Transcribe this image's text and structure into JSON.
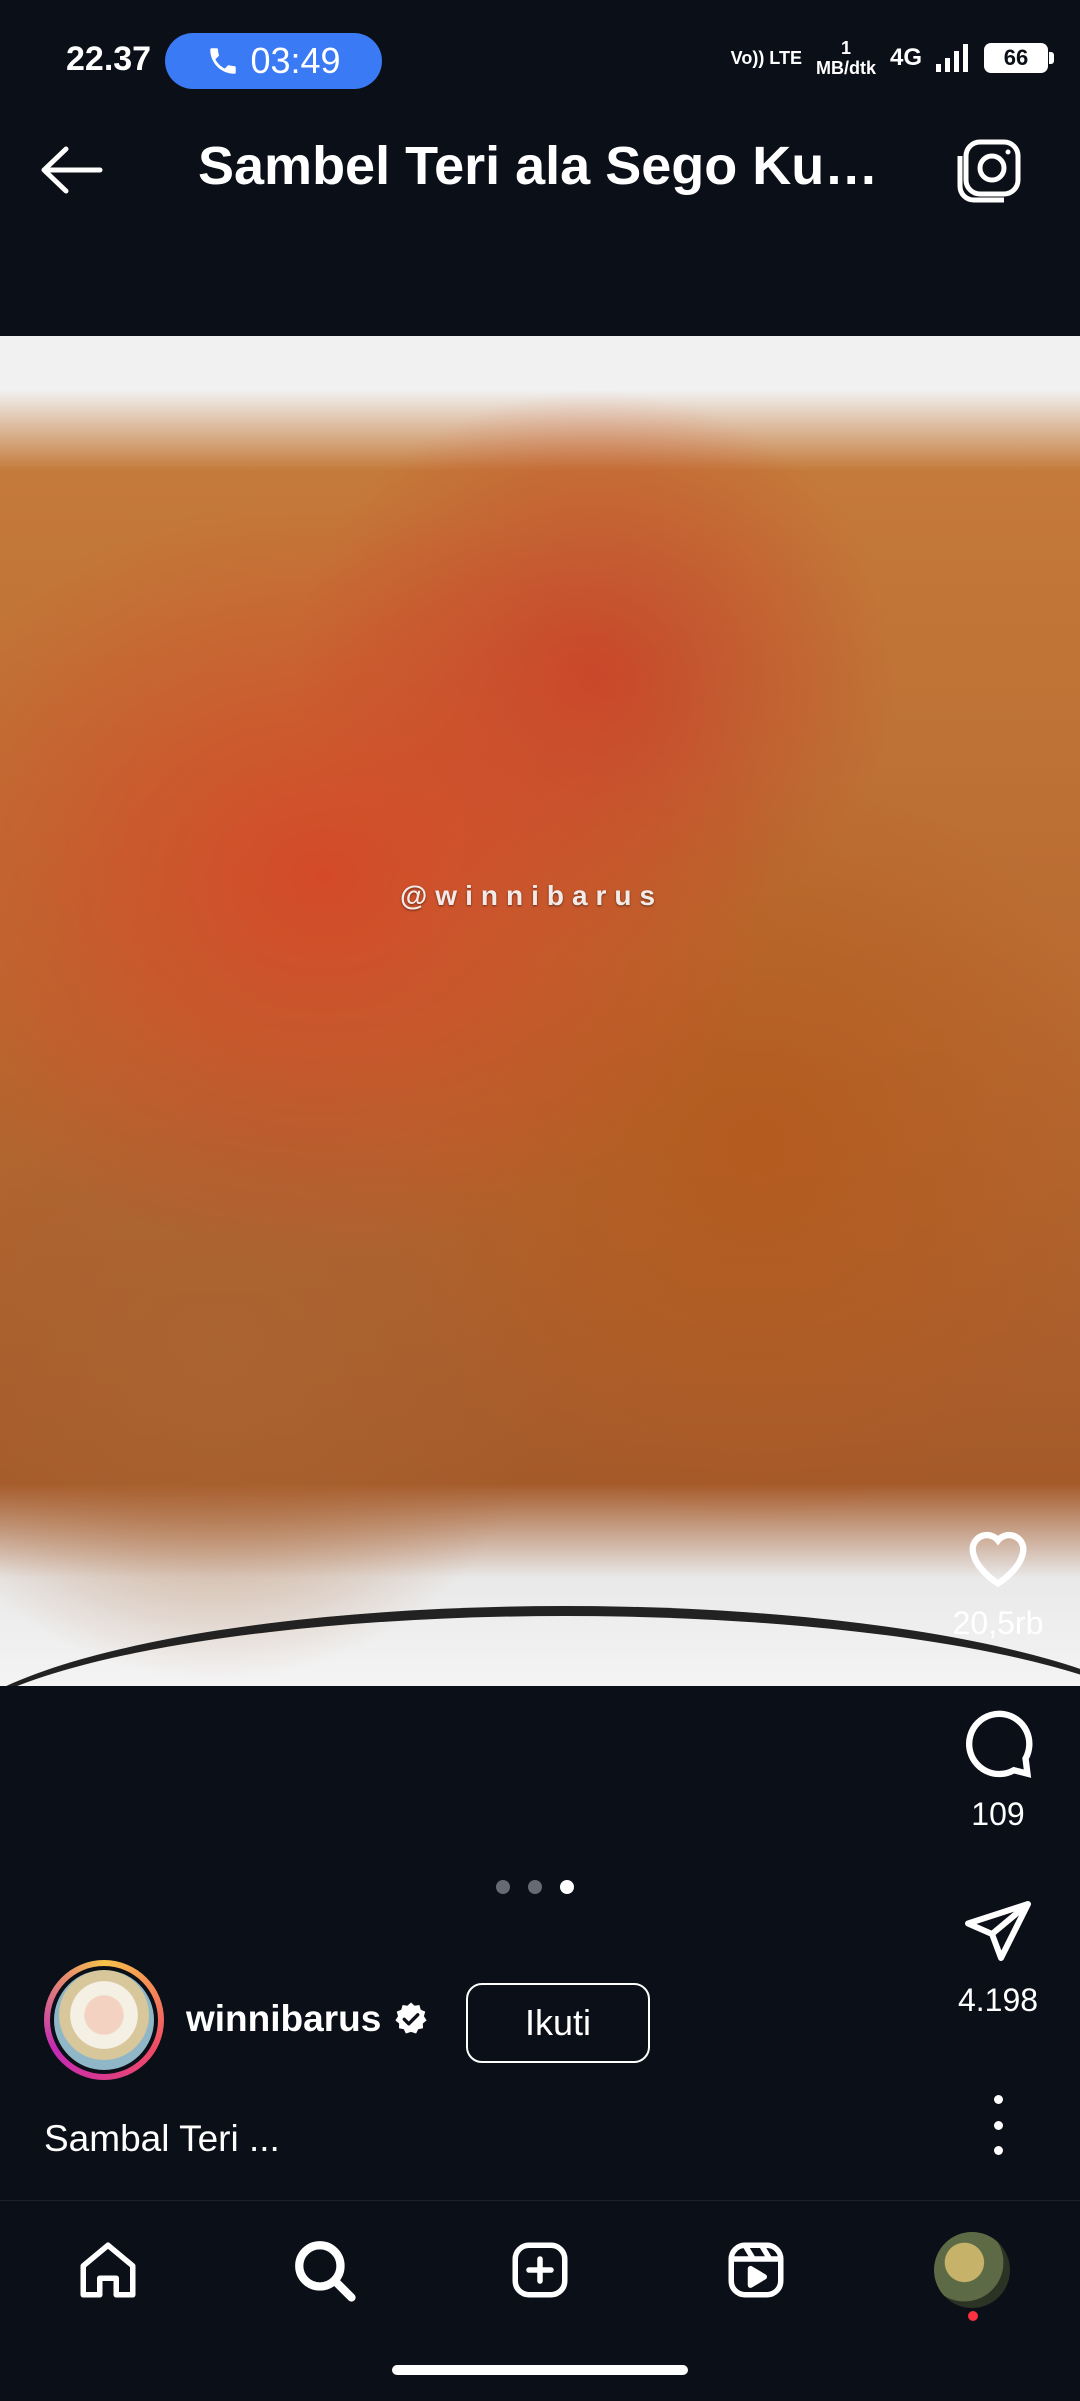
{
  "status_bar": {
    "time": "22.37",
    "call_timer": "03:49",
    "volte": "Vo)) LTE",
    "data_rate_value": "1",
    "data_rate_unit": "MB/dtk",
    "network": "4G",
    "battery": "66"
  },
  "header": {
    "title": "Sambel Teri ala Sego Kuci...",
    "back_icon": "arrow-left-icon",
    "camera_icon": "camera-icon"
  },
  "post": {
    "image_alt": "Sambal teri in a white dish",
    "watermark": "@winnibarus",
    "carousel": {
      "total": 3,
      "active": 3
    },
    "likes": "20,5rb",
    "comments": "109",
    "shares": "4.198",
    "author": {
      "username": "winnibarus",
      "verified": true,
      "follow_label": "Ikuti"
    },
    "caption": "Sambal Teri ..."
  },
  "nav": {
    "items": [
      "home-icon",
      "search-icon",
      "add-icon",
      "reels-icon",
      "profile-avatar"
    ]
  },
  "colors": {
    "background": "#0b0f17",
    "call_pill": "#3a7af5",
    "notification_dot": "#ff3040"
  }
}
